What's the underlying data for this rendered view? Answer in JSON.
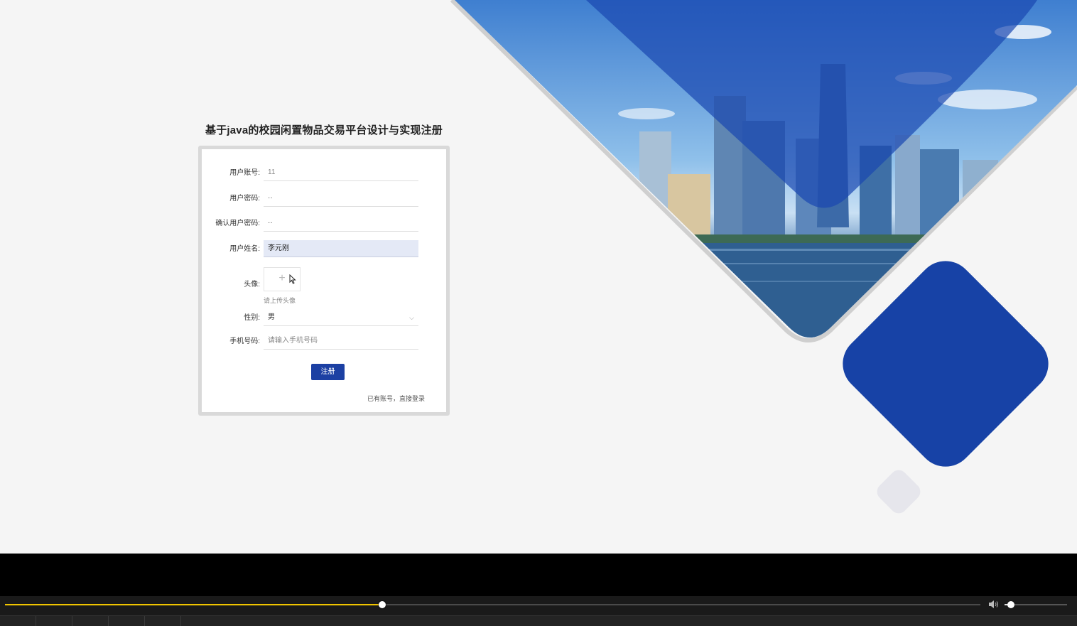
{
  "page": {
    "title": "基于java的校园闲置物品交易平台设计与实现注册"
  },
  "form": {
    "fields": [
      {
        "label": "用户账号:",
        "value": "11"
      },
      {
        "label": "用户密码:",
        "value": "··"
      },
      {
        "label": "确认用户密码:",
        "value": "··"
      },
      {
        "label": "用户姓名:",
        "value": "李元刚"
      }
    ],
    "avatar": {
      "label": "头像:",
      "hint": "请上传头像"
    },
    "gender": {
      "label": "性别:",
      "value": "男"
    },
    "phone": {
      "label": "手机号码:",
      "placeholder": "请输入手机号码"
    },
    "submit_label": "注册",
    "login_link": "已有账号，直接登录"
  },
  "player": {
    "progress_fraction": 0.387,
    "volume_fraction": 0.1,
    "accent_color": "#f0c400"
  },
  "colors": {
    "primary": "#1c40a3",
    "background": "#f5f5f5",
    "diamond": "#1742a6"
  },
  "icons": {
    "upload": "plus-icon",
    "select": "chevron-down-icon",
    "volume": "volume-icon",
    "cursor": "mouse-pointer-icon"
  }
}
